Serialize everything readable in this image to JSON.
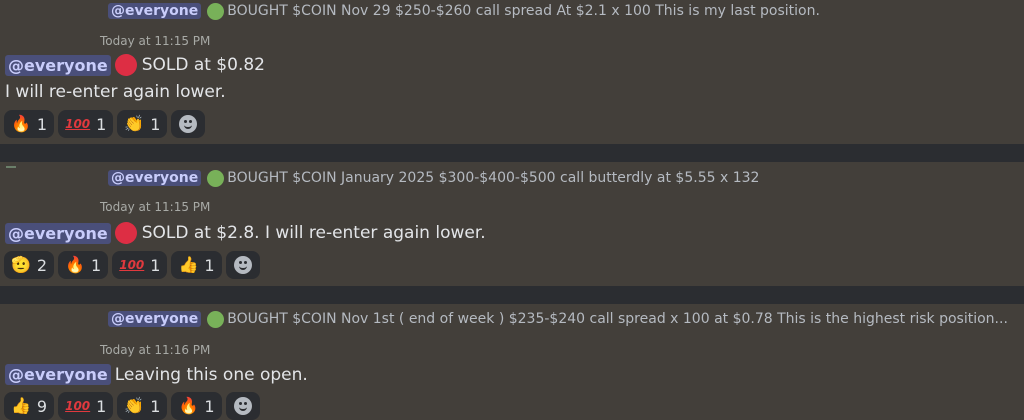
{
  "messages": [
    {
      "reply": {
        "mention": "@everyone",
        "text": "BOUGHT $COIN Nov 29  $250-$260 call spread At $2.1 x 100  This is my last position."
      },
      "timestamp": "Today at 11:15 PM",
      "mention": "@everyone",
      "text": "SOLD at $0.82",
      "text2": "I will re-enter again lower.",
      "reactions": [
        {
          "emoji": "🔥",
          "icon": "fire-icon",
          "count": "1"
        },
        {
          "emoji": "100",
          "icon": "hundred-points-icon",
          "count": "1"
        },
        {
          "emoji": "👏",
          "icon": "clapping-hands-icon",
          "count": "1"
        }
      ]
    },
    {
      "reply": {
        "mention": "@everyone",
        "text": "BOUGHT $COIN January 2025 $300-$400-$500 call butterdly at $5.55 x 132"
      },
      "timestamp": "Today at 11:15 PM",
      "mention": "@everyone",
      "text": "SOLD at $2.8. I will re-enter again lower.",
      "reactions": [
        {
          "emoji": "🫡",
          "icon": "saluting-face-icon",
          "count": "2"
        },
        {
          "emoji": "🔥",
          "icon": "fire-icon",
          "count": "1"
        },
        {
          "emoji": "100",
          "icon": "hundred-points-icon",
          "count": "1"
        },
        {
          "emoji": "👍",
          "icon": "thumbs-up-icon",
          "count": "1"
        }
      ]
    },
    {
      "reply": {
        "mention": "@everyone",
        "text": "BOUGHT $COIN Nov 1st ( end of week ) $235-$240 call spread x 100 at $0.78  This is the highest risk position..."
      },
      "timestamp": "Today at 11:16 PM",
      "mention": "@everyone",
      "text": "Leaving this one open.",
      "reactions": [
        {
          "emoji": "👍",
          "icon": "thumbs-up-icon",
          "count": "9"
        },
        {
          "emoji": "100",
          "icon": "hundred-points-icon",
          "count": "1"
        },
        {
          "emoji": "👏",
          "icon": "clapping-hands-icon",
          "count": "1"
        },
        {
          "emoji": "🔥",
          "icon": "fire-icon",
          "count": "1"
        }
      ]
    }
  ],
  "colors": {
    "background": "#433f3a",
    "divider": "#2b2d31",
    "mention_bg": "#4a4f7a",
    "mention_text": "#c9cdfb",
    "green_circle": "#78b159",
    "red_circle": "#dd2e44"
  }
}
